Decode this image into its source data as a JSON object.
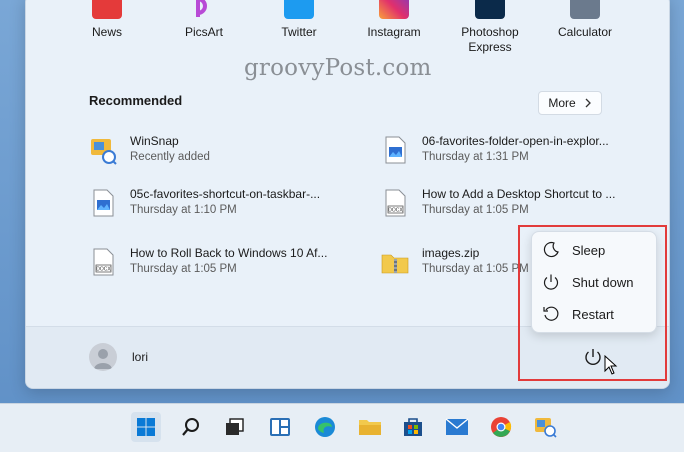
{
  "pinned_apps": [
    {
      "name": "News",
      "color": "#e43a3a"
    },
    {
      "name": "PicsArt",
      "color": "#b84ad6"
    },
    {
      "name": "Twitter",
      "color": "#1d9bf0"
    },
    {
      "name": "Instagram",
      "color": "#e1306c"
    },
    {
      "name": "Photoshop Express",
      "color": "#0b2a4a"
    },
    {
      "name": "Calculator",
      "color": "#6b7a8d"
    }
  ],
  "watermark": "groovyPost.com",
  "recommended": {
    "title": "Recommended",
    "more_label": "More",
    "items": [
      {
        "name": "WinSnap",
        "time": "Recently added",
        "icon": "winsnap-icon"
      },
      {
        "name": "06-favorites-folder-open-in-explor...",
        "time": "Thursday at 1:31 PM",
        "icon": "image-file-icon"
      },
      {
        "name": "05c-favorites-shortcut-on-taskbar-...",
        "time": "Thursday at 1:10 PM",
        "icon": "image-file-icon"
      },
      {
        "name": "How to Add a Desktop Shortcut to ...",
        "time": "Thursday at 1:05 PM",
        "icon": "docx-file-icon"
      },
      {
        "name": "How to Roll Back to Windows 10 Af...",
        "time": "Thursday at 1:05 PM",
        "icon": "docx-file-icon"
      },
      {
        "name": "images.zip",
        "time": "Thursday at 1:05 PM",
        "icon": "zip-folder-icon"
      }
    ]
  },
  "user": {
    "name": "lori"
  },
  "power_menu": {
    "items": [
      {
        "label": "Sleep",
        "icon": "moon-icon"
      },
      {
        "label": "Shut down",
        "icon": "power-icon"
      },
      {
        "label": "Restart",
        "icon": "restart-icon"
      }
    ]
  },
  "taskbar": {
    "icons": [
      "start-icon",
      "search-icon",
      "task-view-icon",
      "widgets-icon",
      "edge-icon",
      "file-explorer-icon",
      "store-icon",
      "mail-icon",
      "chrome-icon",
      "winsnap-icon"
    ]
  },
  "colors": {
    "highlight_box": "#e23b3b",
    "accent": "#0067c0"
  }
}
